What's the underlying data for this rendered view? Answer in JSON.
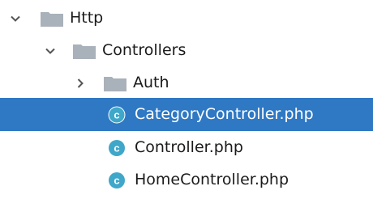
{
  "tree": {
    "items": [
      {
        "label": "Http",
        "type": "folder",
        "expanded": true
      },
      {
        "label": "Controllers",
        "type": "folder",
        "expanded": true
      },
      {
        "label": "Auth",
        "type": "folder",
        "expanded": false
      },
      {
        "label": "CategoryController.php",
        "type": "class-file",
        "selected": true
      },
      {
        "label": "Controller.php",
        "type": "class-file"
      },
      {
        "label": "HomeController.php",
        "type": "class-file"
      }
    ]
  },
  "colors": {
    "selection": "#2f78c4",
    "folder": "#a9b1ba",
    "class_icon": "#3fa7c9"
  }
}
